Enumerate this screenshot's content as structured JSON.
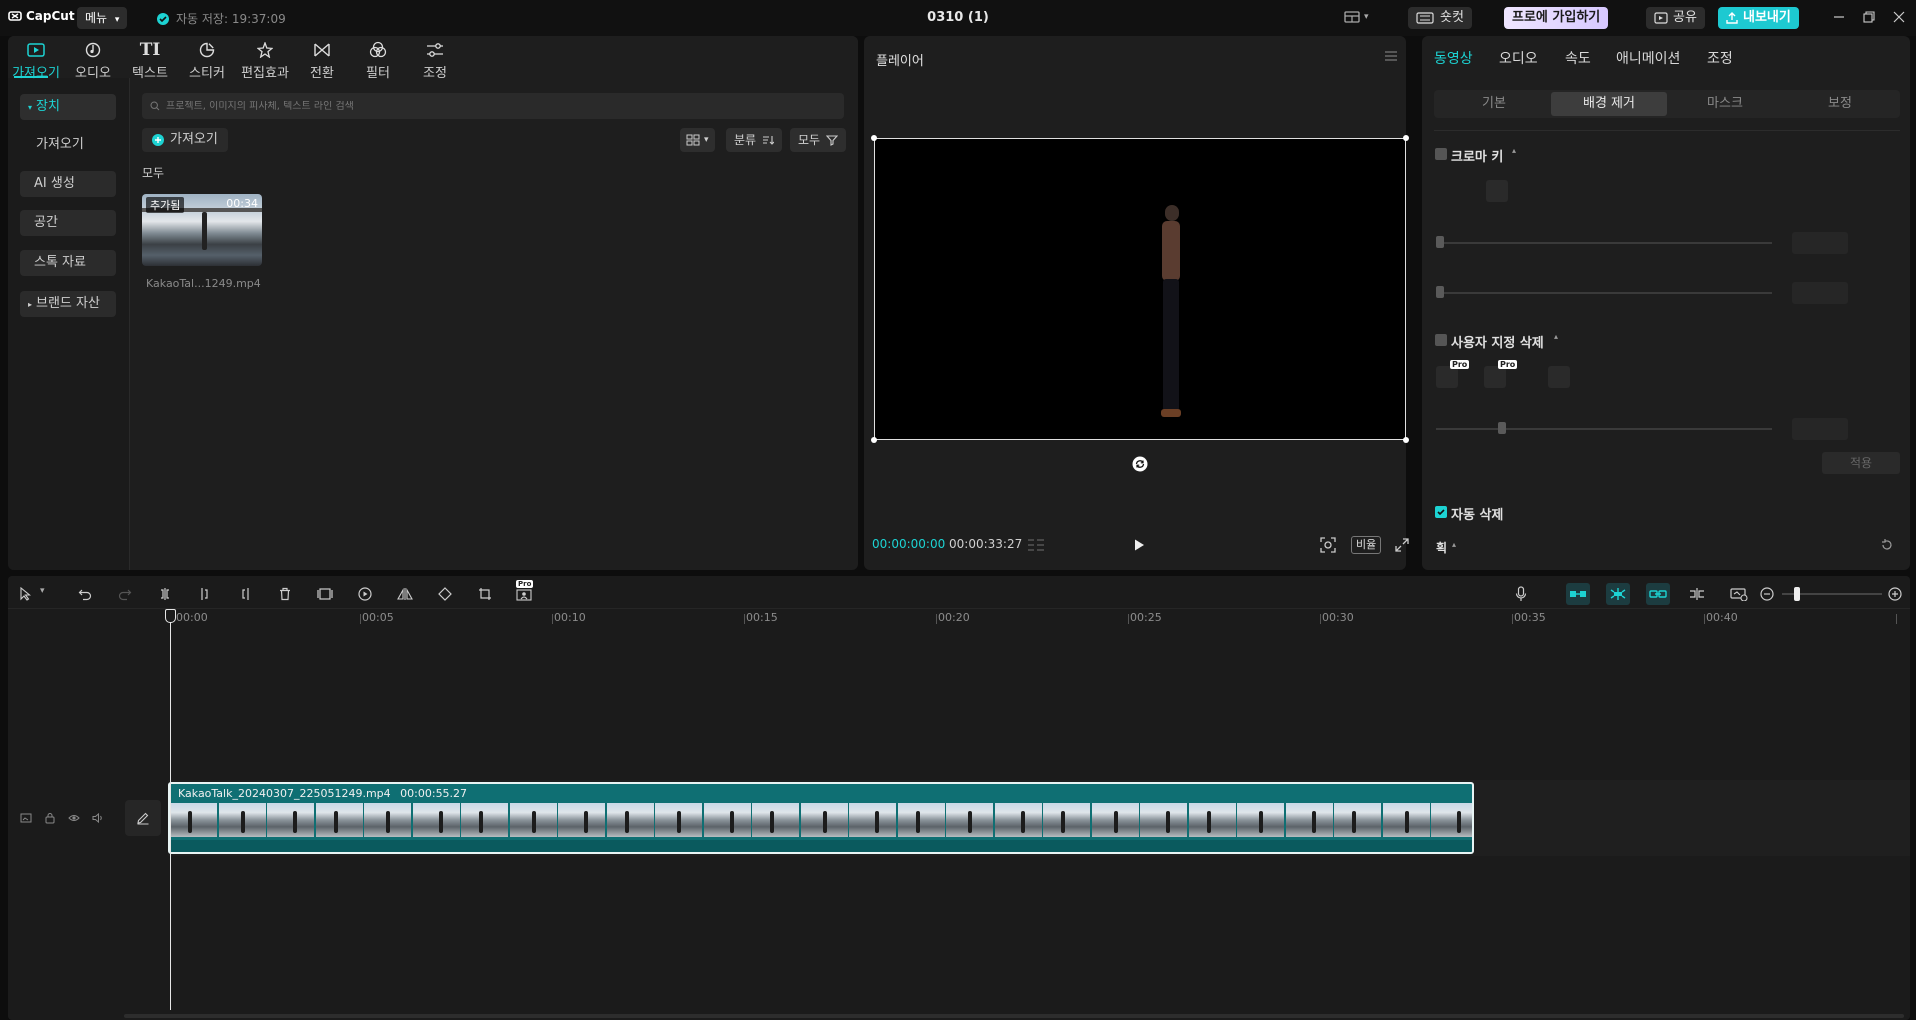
{
  "titlebar": {
    "logo": "CapCut",
    "menu_label": "메뉴",
    "autosave": "자동 저장: 19:37:09",
    "project_title": "0310 (1)",
    "shortcut_label": "숏컷",
    "pro_label": "프로에 가입하기",
    "share_label": "공유",
    "export_label": "내보내기"
  },
  "media_tools": [
    {
      "label": "가져오기",
      "icon": "import-icon",
      "active": true
    },
    {
      "label": "오디오",
      "icon": "audio-icon"
    },
    {
      "label": "텍스트",
      "icon": "text-icon"
    },
    {
      "label": "스티커",
      "icon": "sticker-icon"
    },
    {
      "label": "편집효과",
      "icon": "effects-icon"
    },
    {
      "label": "전환",
      "icon": "transition-icon"
    },
    {
      "label": "필터",
      "icon": "filter-icon"
    },
    {
      "label": "조정",
      "icon": "adjust-icon"
    }
  ],
  "media_sidebar": [
    {
      "label": "장치",
      "active": true,
      "caret": true
    },
    {
      "label": "가져오기"
    },
    {
      "label": "AI 생성"
    },
    {
      "label": "공간"
    },
    {
      "label": "스톡 자료"
    },
    {
      "label": "브랜드 자산",
      "caret": true
    }
  ],
  "media_panel": {
    "search_placeholder": "프로젝트, 이미지의 피사체, 텍스트 라인 검색",
    "import_button": "가져오기",
    "sort_label": "분류",
    "filter_label": "모두",
    "section_label": "모두",
    "clip": {
      "badge": "추가됨",
      "duration": "00:34",
      "name": "KakaoTal...1249.mp4"
    }
  },
  "player": {
    "title": "플레이어",
    "current_time": "00:00:00:00",
    "total_time": "00:00:33:27",
    "ratio_label": "비율"
  },
  "right_panel": {
    "tabs": [
      "동영상",
      "오디오",
      "속도",
      "애니메이션",
      "조정"
    ],
    "active_tab": 0,
    "segments": [
      "기본",
      "배경 제거",
      "마스크",
      "보정"
    ],
    "active_segment": 1,
    "chroma_key_label": "크로마 키",
    "custom_remove_label": "사용자 지정 삭제",
    "pro_badge": "Pro",
    "apply_label": "적용",
    "auto_remove_label": "자동 삭제",
    "stroke_label": "획"
  },
  "timeline": {
    "ticks": [
      "00:00",
      "00:05",
      "00:10",
      "00:15",
      "00:20",
      "00:25",
      "00:30",
      "00:35",
      "00:40"
    ],
    "clip_label": "KakaoTalk_20240307_225051249.mp4",
    "clip_duration": "00:00:55.27",
    "pro_badge": "Pro"
  },
  "colors": {
    "accent": "#1dd3d3",
    "clip_teal": "#0f6f73",
    "pro_gradient_start": "#d7c8ff"
  }
}
